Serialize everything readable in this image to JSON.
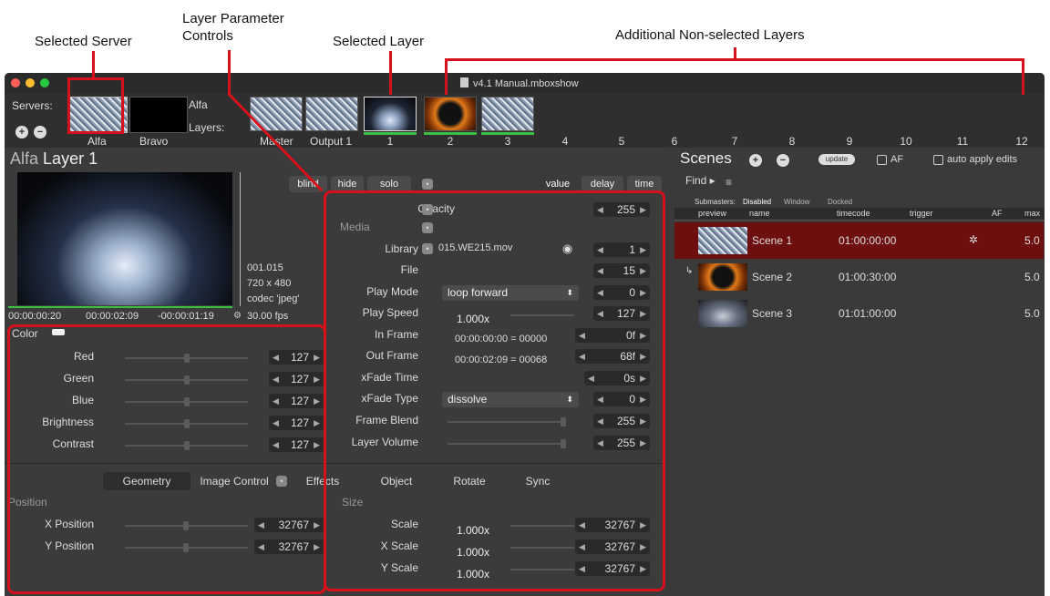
{
  "annotations": {
    "selected_server": "Selected Server",
    "layer_param_line1": "Layer Parameter",
    "layer_param_line2": "Controls",
    "selected_layer": "Selected Layer",
    "additional_layers": "Additional Non-selected Layers"
  },
  "window": {
    "title": "v4.1 Manual.mboxshow"
  },
  "servers": {
    "label": "Servers:",
    "items": [
      "Alfa",
      "Bravo"
    ],
    "current": "Alfa",
    "add": "+",
    "remove": "−"
  },
  "layers": {
    "label": "Layers:",
    "master": "Master",
    "output": "Output 1",
    "numbers": [
      "1",
      "2",
      "3",
      "4",
      "5",
      "6",
      "7",
      "8",
      "9",
      "10",
      "11",
      "12"
    ]
  },
  "panel": {
    "title_server": "Alfa",
    "title_layer": "Layer 1",
    "blind": "blind",
    "hide": "hide",
    "solo": "solo",
    "view_modes": [
      "value",
      "delay",
      "time"
    ],
    "preview_info": [
      "001.015",
      "720 x 480",
      "codec 'jpeg'",
      "30.00 fps"
    ],
    "timecodes": {
      "current": "00:00:00:20",
      "duration": "00:00:02:09",
      "remaining": "-00:00:01:19"
    }
  },
  "color": {
    "label": "Color",
    "rows": [
      {
        "name": "Red",
        "value": "127",
        "level": 0.5
      },
      {
        "name": "Green",
        "value": "127",
        "level": 0.5
      },
      {
        "name": "Blue",
        "value": "127",
        "level": 0.5
      },
      {
        "name": "Brightness",
        "value": "127",
        "level": 0.5
      },
      {
        "name": "Contrast",
        "value": "127",
        "level": 0.5
      }
    ]
  },
  "params": {
    "opacity": {
      "label": "Opacity",
      "value": "255"
    },
    "media_label": "Media",
    "library": {
      "label": "Library",
      "file_name": "015.WE215.mov",
      "value": "1"
    },
    "file": {
      "label": "File",
      "value": "15"
    },
    "play_mode": {
      "label": "Play Mode",
      "value": "loop forward",
      "num": "0"
    },
    "play_speed": {
      "label": "Play Speed",
      "field": "1.000x",
      "value": "127"
    },
    "in_frame": {
      "label": "In Frame",
      "field": "00:00:00:00 = 00000",
      "value": "0f"
    },
    "out_frame": {
      "label": "Out Frame",
      "field": "00:00:02:09 = 00068",
      "value": "68f"
    },
    "xfade_time": {
      "label": "xFade Time",
      "value": "0s"
    },
    "xfade_type": {
      "label": "xFade Type",
      "value": "dissolve",
      "num": "0"
    },
    "frame_blend": {
      "label": "Frame Blend",
      "value": "255",
      "level": 1.0
    },
    "layer_volume": {
      "label": "Layer Volume",
      "value": "255",
      "level": 1.0
    }
  },
  "tabs": [
    "Geometry",
    "Image Control",
    "Effects",
    "Object",
    "Rotate",
    "Sync"
  ],
  "geometry": {
    "position_label": "Position",
    "size_label": "Size",
    "x_position": {
      "label": "X Position",
      "value": "32767"
    },
    "y_position": {
      "label": "Y Position",
      "value": "32767"
    },
    "scale": {
      "label": "Scale",
      "field": "1.000x",
      "value": "32767"
    },
    "x_scale": {
      "label": "X Scale",
      "field": "1.000x",
      "value": "32767"
    },
    "y_scale": {
      "label": "Y Scale",
      "field": "1.000x",
      "value": "32767"
    }
  },
  "scenes": {
    "title": "Scenes",
    "update": "update",
    "af": "AF",
    "auto_apply": "auto apply edits",
    "find": "Find ▸",
    "submasters": "Submasters:",
    "submaster_modes": [
      "Disabled",
      "Window",
      "Docked"
    ],
    "columns": [
      "preview",
      "name",
      "timecode",
      "trigger",
      "AF",
      "max"
    ],
    "rows": [
      {
        "name": "Scene 1",
        "timecode": "01:00:00:00",
        "max": "5.0",
        "selected": true
      },
      {
        "name": "Scene 2",
        "timecode": "01:00:30:00",
        "max": "5.0",
        "selected": false
      },
      {
        "name": "Scene 3",
        "timecode": "01:01:00:00",
        "max": "5.0",
        "selected": false
      }
    ]
  },
  "colors": {
    "accent_red": "#d8101b",
    "selected_row": "#6e0f0f",
    "green_bar": "#3fbf3f"
  }
}
